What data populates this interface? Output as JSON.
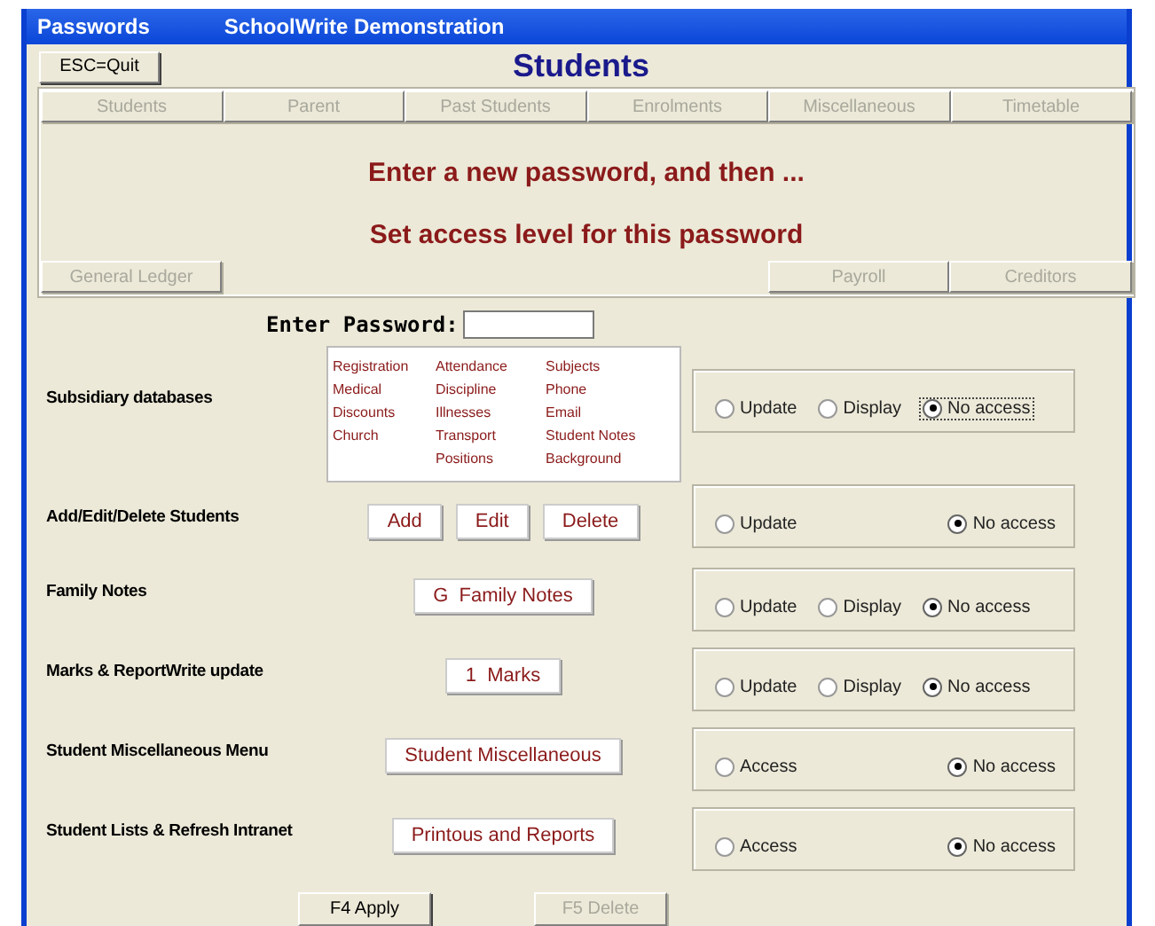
{
  "window": {
    "title": "Passwords",
    "subtitle": "SchoolWrite Demonstration"
  },
  "quit_button": {
    "label": "ESC=Quit"
  },
  "heading": "Students",
  "nav_buttons": [
    {
      "label": "Students",
      "disabled": true
    },
    {
      "label": "Parent",
      "disabled": true
    },
    {
      "label": "Past Students",
      "disabled": true
    },
    {
      "label": "Enrolments",
      "disabled": true
    },
    {
      "label": "Miscellaneous",
      "disabled": true
    },
    {
      "label": "Timetable",
      "disabled": true
    }
  ],
  "messages": [
    "Enter a new password, and then ...",
    "Set access level for this password"
  ],
  "lower_buttons": [
    {
      "label": "General Ledger",
      "disabled": true
    },
    {
      "label": "Payroll",
      "disabled": true
    },
    {
      "label": "Creditors",
      "disabled": true
    }
  ],
  "password": {
    "label": "Enter Password:"
  },
  "rows": [
    {
      "label": "Subsidiary databases",
      "kind": "list",
      "columns": [
        [
          "Registration",
          "Medical",
          "Discounts",
          "Church"
        ],
        [
          "Attendance",
          "Discipline",
          "Illnesses",
          "Transport",
          "Positions"
        ],
        [
          "Subjects",
          "Phone",
          "Email",
          "Student Notes",
          "Background"
        ]
      ],
      "options": [
        {
          "label": "Update",
          "selected": false,
          "focused": false
        },
        {
          "label": "Display",
          "selected": false,
          "focused": false
        },
        {
          "label": "No access",
          "selected": true,
          "focused": true
        }
      ]
    },
    {
      "label": "Add/Edit/Delete Students",
      "kind": "buttons",
      "buttons": [
        "Add",
        "Edit",
        "Delete"
      ],
      "options": [
        {
          "label": "Update",
          "selected": false,
          "focused": false
        },
        {
          "label": "No access",
          "selected": true,
          "focused": false
        }
      ]
    },
    {
      "label": "Family Notes",
      "kind": "buttons",
      "buttons": [
        "G  Family Notes"
      ],
      "options": [
        {
          "label": "Update",
          "selected": false,
          "focused": false
        },
        {
          "label": "Display",
          "selected": false,
          "focused": false
        },
        {
          "label": "No access",
          "selected": true,
          "focused": false
        }
      ]
    },
    {
      "label": "Marks & ReportWrite update",
      "kind": "buttons",
      "buttons": [
        "1  Marks"
      ],
      "options": [
        {
          "label": "Update",
          "selected": false,
          "focused": false
        },
        {
          "label": "Display",
          "selected": false,
          "focused": false
        },
        {
          "label": "No access",
          "selected": true,
          "focused": false
        }
      ]
    },
    {
      "label": "Student Miscellaneous Menu",
      "kind": "buttons",
      "buttons": [
        "Student Miscellaneous"
      ],
      "options": [
        {
          "label": "Access",
          "selected": false,
          "focused": false
        },
        {
          "label": "No access",
          "selected": true,
          "focused": false
        }
      ]
    },
    {
      "label": "Student Lists & Refresh Intranet",
      "kind": "buttons",
      "buttons": [
        "Printous and Reports"
      ],
      "options": [
        {
          "label": "Access",
          "selected": false,
          "focused": false
        },
        {
          "label": "No access",
          "selected": true,
          "focused": false
        }
      ]
    }
  ],
  "footer_buttons": [
    {
      "label": "F4 Apply",
      "disabled": false
    },
    {
      "label": "F5 Delete",
      "disabled": true
    }
  ]
}
